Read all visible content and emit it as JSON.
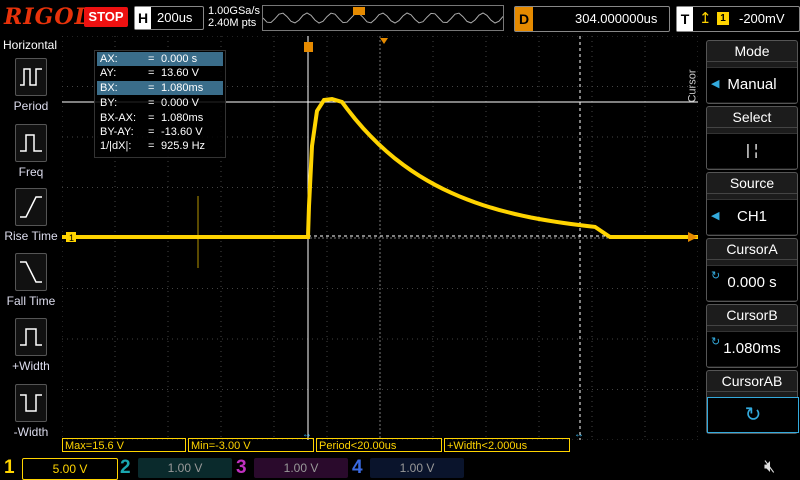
{
  "top": {
    "brand": "RIGOL",
    "run_state": "STOP",
    "horizontal_label": "H",
    "timebase": "200us",
    "sample_rate": "1.00GSa/s",
    "points": "2.40M pts",
    "delay_label": "D",
    "delay_value": "304.000000us",
    "trigger_label": "T",
    "trigger_channel": "1",
    "trigger_level": "-200mV"
  },
  "left_panel": {
    "title": "Horizontal",
    "items": [
      {
        "label": "Period",
        "icon": "period-icon"
      },
      {
        "label": "Freq",
        "icon": "frequency-icon"
      },
      {
        "label": "Rise Time",
        "icon": "rise-time-icon"
      },
      {
        "label": "Fall Time",
        "icon": "fall-time-icon"
      },
      {
        "label": "+Width",
        "icon": "positive-width-icon"
      },
      {
        "label": "-Width",
        "icon": "negative-width-icon"
      }
    ]
  },
  "readout": [
    {
      "key": "AX:",
      "value": "0.000 s",
      "highlight": true
    },
    {
      "key": "AY:",
      "value": "13.60 V",
      "highlight": false
    },
    {
      "key": "BX:",
      "value": "1.080ms",
      "highlight": true
    },
    {
      "key": "BY:",
      "value": "0.000 V",
      "highlight": false
    },
    {
      "key": "BX-AX:",
      "value": "1.080ms",
      "highlight": false
    },
    {
      "key": "BY-AY:",
      "value": "-13.60 V",
      "highlight": false
    },
    {
      "key": "1/|dX|:",
      "value": "925.9 Hz",
      "highlight": false
    }
  ],
  "right_panel": {
    "tab": "Cursor",
    "mode_title": "Mode",
    "mode_value": "Manual",
    "select_title": "Select",
    "select_value": "|   ¦",
    "source_title": "Source",
    "source_value": "CH1",
    "cursor_a_title": "CursorA",
    "cursor_a_value": "0.000 s",
    "cursor_b_title": "CursorB",
    "cursor_b_value": "1.080ms",
    "cursor_ab_title": "CursorAB"
  },
  "measurements": {
    "max": "Max=15.6 V",
    "min": "Min=-3.00 V",
    "period": "Period<20.00us",
    "width": "+Width<2.000us"
  },
  "channels": [
    {
      "num": "1",
      "scale": "5.00 V",
      "color": "#ffd400",
      "active": true
    },
    {
      "num": "2",
      "scale": "1.00 V",
      "color": "#1aa7b0",
      "active": false
    },
    {
      "num": "3",
      "scale": "1.00 V",
      "color": "#c030c0",
      "active": false
    },
    {
      "num": "4",
      "scale": "1.00 V",
      "color": "#3a6ae0",
      "active": false
    }
  ],
  "colors": {
    "ch1": "#ffd400",
    "accent": "#e58a00",
    "stop": "#ee1111"
  }
}
